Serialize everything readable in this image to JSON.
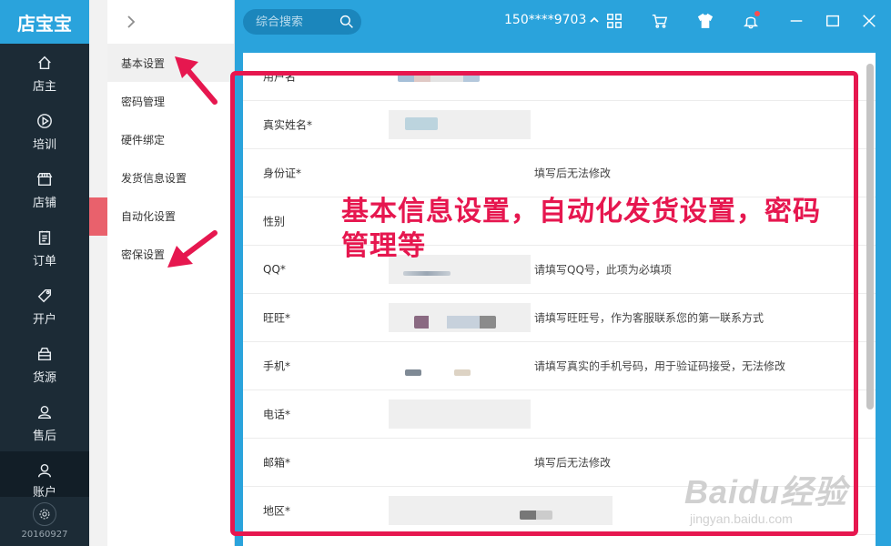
{
  "app": {
    "name": "店宝宝"
  },
  "nav": [
    {
      "label": "店主",
      "icon": "home-icon"
    },
    {
      "label": "培训",
      "icon": "play-icon"
    },
    {
      "label": "店铺",
      "icon": "store-icon"
    },
    {
      "label": "订单",
      "icon": "clipboard-icon"
    },
    {
      "label": "开户",
      "icon": "tag-icon"
    },
    {
      "label": "货源",
      "icon": "box-icon"
    },
    {
      "label": "售后",
      "icon": "headset-icon"
    },
    {
      "label": "账户",
      "icon": "user-icon"
    }
  ],
  "footer": {
    "version": "20160927"
  },
  "submenu": [
    {
      "label": "基本设置",
      "active": true
    },
    {
      "label": "密码管理"
    },
    {
      "label": "硬件绑定"
    },
    {
      "label": "发货信息设置"
    },
    {
      "label": "自动化设置"
    },
    {
      "label": "密保设置"
    }
  ],
  "topbar": {
    "search_placeholder": "综合搜索",
    "username": "150****9703",
    "icons": [
      "grid-icon",
      "cart-icon",
      "shirt-icon",
      "bell-icon",
      "minimize-icon",
      "maximize-icon",
      "close-icon"
    ]
  },
  "form": {
    "rows": [
      {
        "label": "用户名",
        "hint": ""
      },
      {
        "label": "真实姓名*",
        "hint": ""
      },
      {
        "label": "身份证*",
        "hint": "填写后无法修改"
      },
      {
        "label": "性别",
        "hint": ""
      },
      {
        "label": "QQ*",
        "hint": "请填写QQ号，此项为必填项"
      },
      {
        "label": "旺旺*",
        "hint": "请填写旺旺号，作为客服联系您的第一联系方式"
      },
      {
        "label": "手机*",
        "hint": "请填写真实的手机号码，用于验证码接受，无法修改"
      },
      {
        "label": "电话*",
        "hint": ""
      },
      {
        "label": "邮箱*",
        "hint": "填写后无法修改"
      },
      {
        "label": "地区*",
        "hint": ""
      }
    ]
  },
  "annotation": {
    "text": "基本信息设置，自动化发货设置，密码管理等",
    "color": "#e6174f"
  },
  "watermark": {
    "main": "Baidu经验",
    "sub": "jingyan.baidu.com"
  },
  "colors": {
    "topbar": "#2aa3dc",
    "sidebar": "#1c2b36",
    "accent": "#e6174f"
  }
}
